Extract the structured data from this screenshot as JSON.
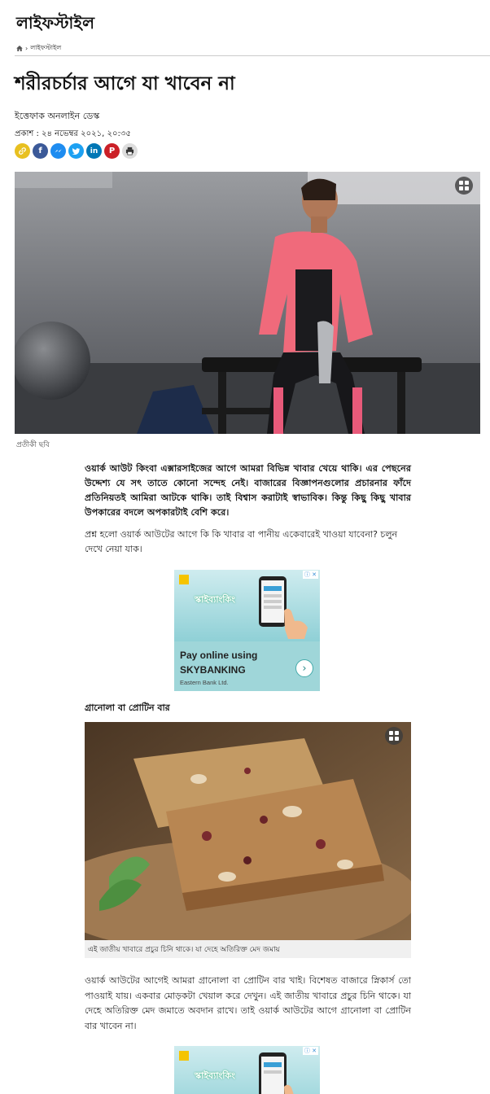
{
  "site": {
    "title": "লাইফস্টাইল"
  },
  "breadcrumb": {
    "items": [
      "লাইফস্টাইল"
    ]
  },
  "article": {
    "headline": "শরীরচর্চার আগে যা খাবেন না",
    "author": "ইত্তেফাক অনলাইন ডেস্ক",
    "published": "প্রকাশ : ২৪ নভেম্বর ২০২১, ২০:৩৫",
    "hero_caption": "প্রতীকী ছবি",
    "lead": "ওয়ার্ক আউট কিংবা এক্সারসাইজের আগে আমরা বিভিন্ন খাবার খেয়ে থাকি। এর পেছনের উদ্দেশ্য যে সৎ তাতে কোনো সন্দেহ নেই। বাজারের বিজ্ঞাপনগুলোর প্রচারনার ফাঁদে প্রতিনিয়তই আমিরা আটকে থাকি। তাই বিশ্বাস করাটাই স্বাভাবিক। কিন্তু কিছু কিছু খাবার উপকারের বদলে অপকারটাই বেশি করে।",
    "para1": "প্রশ্ন হলো ওয়ার্ক আউটের আগে কি কি খাবার বা পানীয় একেবারেই খাওয়া যাবেনা? চলুন দেখে নেয়া যাক।",
    "subhead1": "গ্রানোলা বা প্রোটিন বার",
    "image2_caption": "এই জাতীয় খাবারে প্রচুর চিনি থাকে। যা দেহে অতিরিক্ত মেদ জমায়",
    "para2": "ওয়ার্ক আউটের আগেই আমরা গ্রানোলা বা প্রোটিন বার খাই। বিশেষত বাজারে স্নিকার্স তো পাওয়াই যায়। একবার মোড়কটা খেয়াল করে দেখুন। এই জাতীয় খাবারে প্রচুর চিনি থাকে। যা দেহে অতিরিক্ত মেদ জমাতে অবদান রাখে। তাই ওয়ার্ক আউটের আগে গ্রানোলা বা প্রোটিন বার খাবেন না।"
  },
  "share": {
    "icons": [
      "link-icon",
      "facebook-icon",
      "messenger-icon",
      "twitter-icon",
      "linkedin-icon",
      "pinterest-icon",
      "print-icon"
    ],
    "colors": [
      "#e8c020",
      "#3b5998",
      "#1e8cf0",
      "#1da1f2",
      "#0077b5",
      "#cb2027",
      "#dddddd"
    ]
  },
  "ad": {
    "brand": "স্কাইব্যাংকিং",
    "line1": "Pay online using",
    "line2": "SKYBANKING",
    "advertiser": "Eastern Bank Ltd.",
    "choices": "ⓘ ✕"
  }
}
